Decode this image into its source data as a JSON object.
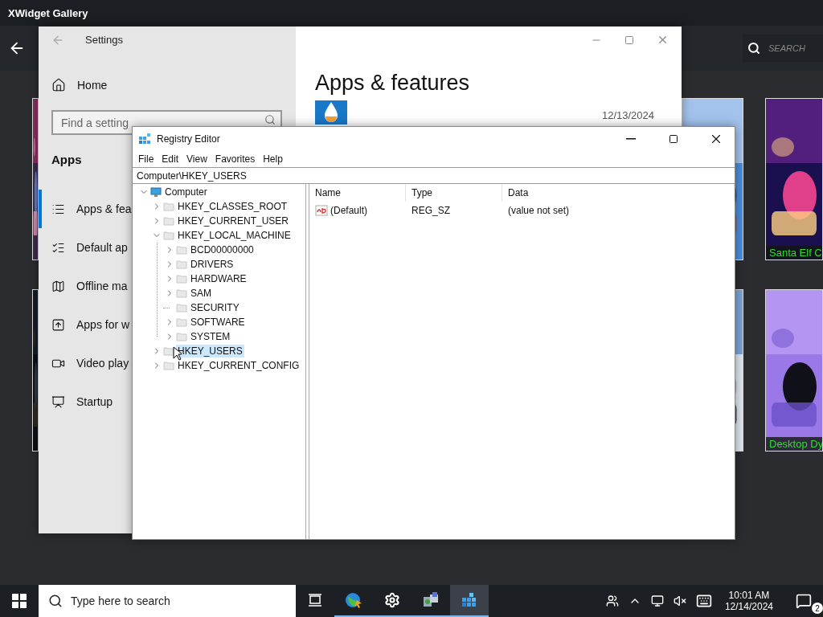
{
  "gallery": {
    "title": "XWidget Gallery",
    "search": {
      "placeholder": "SEARCH"
    },
    "thumbnails": [
      {
        "caption": "Santa Elf C"
      },
      {
        "caption": "Desktop Dy"
      }
    ]
  },
  "settings": {
    "title": "Settings",
    "home": "Home",
    "search": {
      "placeholder": "Find a setting"
    },
    "section": "Apps",
    "nav": [
      {
        "label": "Apps & fea",
        "selected": true
      },
      {
        "label": "Default ap",
        "selected": false
      },
      {
        "label": "Offline ma",
        "selected": false
      },
      {
        "label": "Apps for w",
        "selected": false
      },
      {
        "label": "Video play",
        "selected": false
      },
      {
        "label": "Startup",
        "selected": false
      }
    ],
    "heading": "Apps & features",
    "apps": [
      {
        "date": "12/13/2024"
      }
    ]
  },
  "registry": {
    "title": "Registry Editor",
    "menu": [
      "File",
      "Edit",
      "View",
      "Favorites",
      "Help"
    ],
    "address": "Computer\\HKEY_USERS",
    "tree": [
      {
        "label": "Computer",
        "expandable": true,
        "expanded": true,
        "selected": false,
        "children": [
          {
            "label": "HKEY_CLASSES_ROOT",
            "expandable": true,
            "expanded": false,
            "selected": false
          },
          {
            "label": "HKEY_CURRENT_USER",
            "expandable": true,
            "expanded": false,
            "selected": false
          },
          {
            "label": "HKEY_LOCAL_MACHINE",
            "expandable": true,
            "expanded": true,
            "selected": false,
            "children": [
              {
                "label": "BCD00000000",
                "expandable": true,
                "expanded": false,
                "selected": false
              },
              {
                "label": "DRIVERS",
                "expandable": true,
                "expanded": false,
                "selected": false
              },
              {
                "label": "HARDWARE",
                "expandable": true,
                "expanded": false,
                "selected": false
              },
              {
                "label": "SAM",
                "expandable": true,
                "expanded": false,
                "selected": false
              },
              {
                "label": "SECURITY",
                "expandable": false,
                "expanded": false,
                "selected": false
              },
              {
                "label": "SOFTWARE",
                "expandable": true,
                "expanded": false,
                "selected": false
              },
              {
                "label": "SYSTEM",
                "expandable": true,
                "expanded": false,
                "selected": false
              }
            ]
          },
          {
            "label": "HKEY_USERS",
            "expandable": true,
            "expanded": false,
            "selected": true
          },
          {
            "label": "HKEY_CURRENT_CONFIG",
            "expandable": true,
            "expanded": false,
            "selected": false
          }
        ]
      }
    ],
    "columns": [
      "Name",
      "Type",
      "Data"
    ],
    "rows": [
      {
        "name": "(Default)",
        "type": "REG_SZ",
        "data": "(value not set)"
      }
    ]
  },
  "taskbar": {
    "search": {
      "placeholder": "Type here to search"
    },
    "apps": [
      {
        "selected": false
      },
      {
        "selected": false
      },
      {
        "selected": false
      },
      {
        "selected": false
      },
      {
        "selected": true
      }
    ],
    "time": "10:01 AM",
    "date": "12/14/2024",
    "notifications": "2"
  }
}
